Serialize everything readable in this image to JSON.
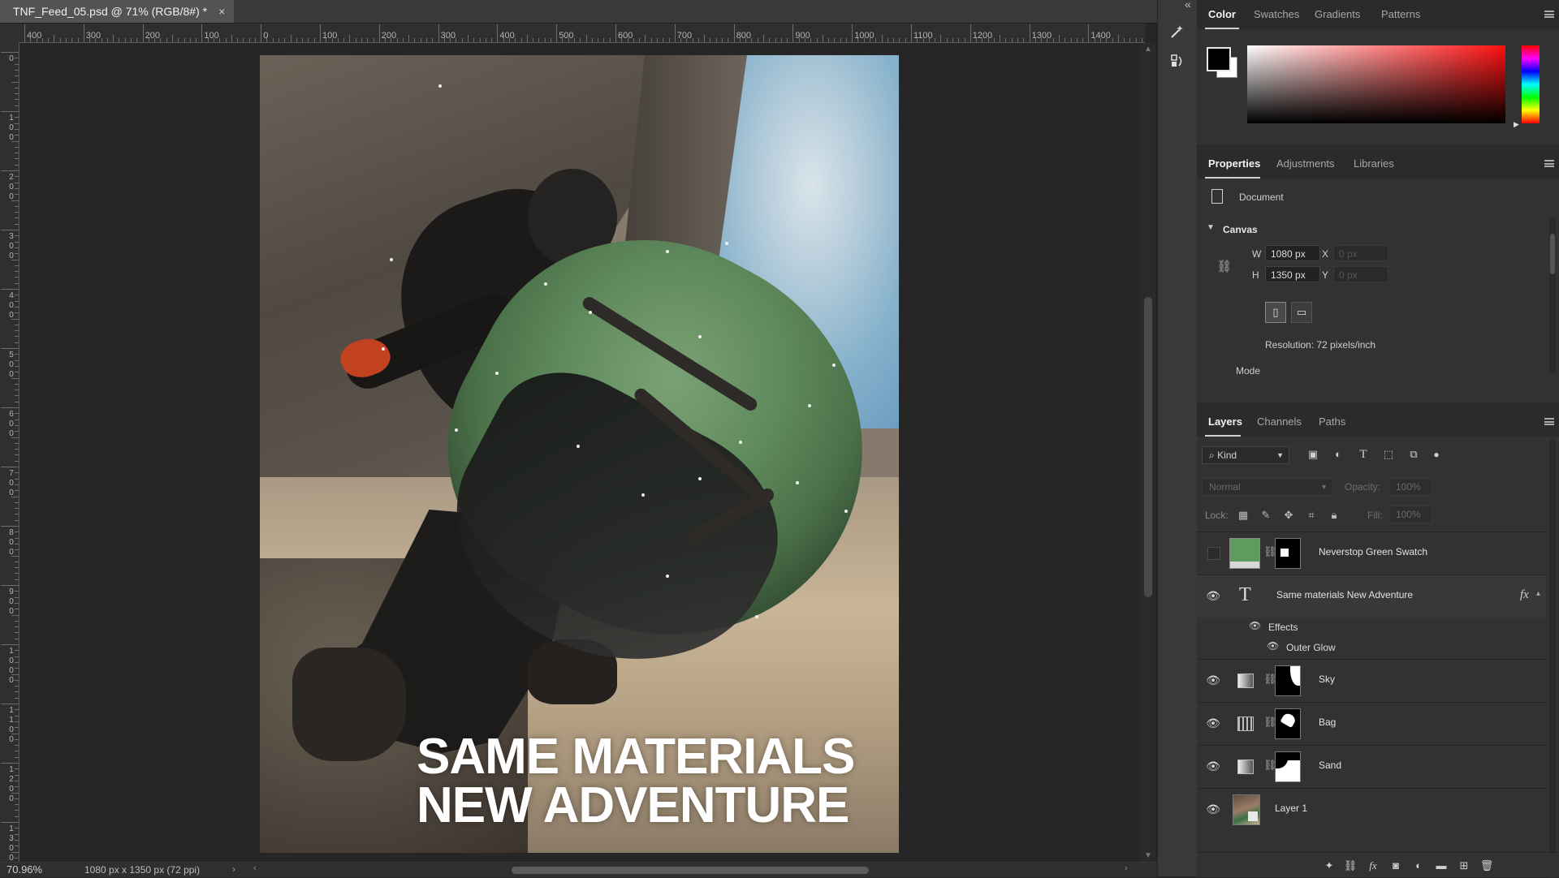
{
  "document_tab": {
    "title": "TNF_Feed_05.psd @ 71% (RGB/8#) *",
    "close_glyph": "×"
  },
  "ruler_top": [
    "400",
    "300",
    "200",
    "100",
    "0",
    "100",
    "200",
    "300",
    "400",
    "500",
    "600",
    "700",
    "800",
    "900",
    "1000",
    "1100",
    "1200",
    "1300",
    "1400"
  ],
  "ruler_left": [
    "0",
    "100",
    "200",
    "300",
    "400",
    "500",
    "600",
    "700",
    "800",
    "900",
    "1000",
    "1100",
    "1200",
    "1300"
  ],
  "artwork": {
    "headline_line1": "SAME MATERIALS",
    "headline_line2": "NEW ADVENTURE",
    "colors": {
      "sky": "#88b2cc",
      "bag_green": "#5f8a5c",
      "glove": "#c2411f",
      "sand": "#c9b597"
    }
  },
  "status_bar": {
    "zoom": "70.96%",
    "doc_info": "1080 px x 1350 px (72 ppi)",
    "arrow": "›"
  },
  "side_strip": {
    "tools": [
      "magic-wand-icon",
      "history-brush-icon"
    ],
    "collapse_glyph": "«"
  },
  "color_panel": {
    "tabs": [
      "Color",
      "Swatches",
      "Gradients",
      "Patterns"
    ],
    "active_tab": "Color",
    "foreground": "#000000",
    "background": "#ffffff",
    "hue": "#ff1010"
  },
  "properties_panel": {
    "tabs": [
      "Properties",
      "Adjustments",
      "Libraries"
    ],
    "active_tab": "Properties",
    "type_label": "Document",
    "canvas_section": "Canvas",
    "w_label": "W",
    "w_value": "1080 px",
    "h_label": "H",
    "h_value": "1350 px",
    "x_label": "X",
    "x_placeholder": "0 px",
    "y_label": "Y",
    "y_placeholder": "0 px",
    "resolution": "Resolution: 72 pixels/inch",
    "mode_label": "Mode"
  },
  "layers_panel": {
    "tabs": [
      "Layers",
      "Channels",
      "Paths"
    ],
    "active_tab": "Layers",
    "filter_kind": "Kind",
    "blend_mode": "Normal",
    "opacity_label": "Opacity:",
    "opacity_value": "100%",
    "lock_label": "Lock:",
    "fill_label": "Fill:",
    "fill_value": "100%",
    "layers": [
      {
        "name": "Neverstop Green Swatch",
        "visible": false,
        "thumb_color": "#5f9a5f"
      },
      {
        "name": "Same materials New Adventure",
        "visible": true,
        "type": "text",
        "fx": "fx"
      },
      {
        "name": "Sky",
        "visible": true
      },
      {
        "name": "Bag",
        "visible": true
      },
      {
        "name": "Sand",
        "visible": true
      },
      {
        "name": "Layer 1",
        "visible": true
      }
    ],
    "effects_label": "Effects",
    "outer_glow_label": "Outer Glow"
  }
}
